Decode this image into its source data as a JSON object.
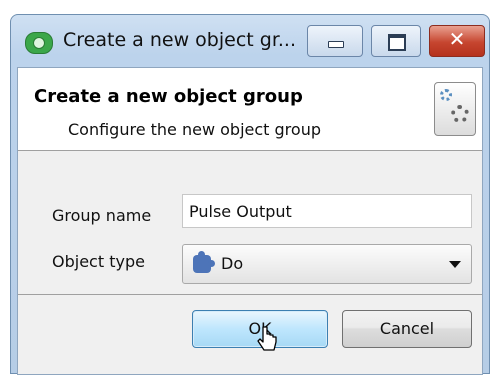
{
  "window": {
    "title": "Create a new object gr...",
    "icon": "eye-app-icon",
    "controls": {
      "minimize": "minimize-icon",
      "maximize": "maximize-icon",
      "close": "✕"
    }
  },
  "header": {
    "title": "Create a new object group",
    "subtitle": "Configure the new object group",
    "icon": "settings-gears-icon"
  },
  "form": {
    "group_name_label": "Group name",
    "group_name_value": "Pulse Output",
    "object_type_label": "Object type",
    "object_type_value": "Do",
    "object_type_icon": "puzzle-piece-icon"
  },
  "buttons": {
    "ok": "OK",
    "cancel": "Cancel"
  },
  "colors": {
    "frame": "#bcd3ec",
    "close_button": "#c6452f",
    "ok_button": "#bee6fd",
    "dialog_background": "#f0f0f0"
  }
}
